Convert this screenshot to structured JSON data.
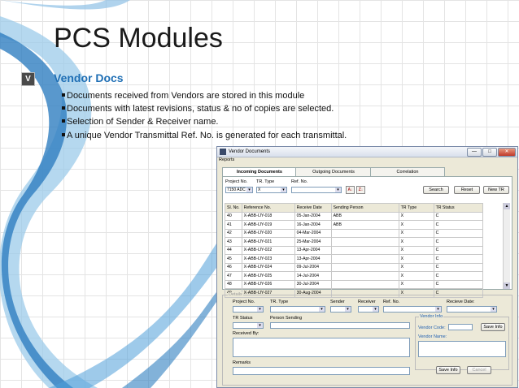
{
  "slide": {
    "title": "PCS Modules",
    "badge": "V",
    "subtitle": "Vendor Docs",
    "bullets": [
      "Documents received from Vendors are stored in this module",
      "Documents with latest revisions, status & no of copies are selected.",
      "Selection of Sender & Receiver name.",
      "A unique Vendor Transmittal Ref. No. is generated for each transmittal."
    ]
  },
  "window": {
    "title": "Vendor Documents",
    "menu": "Reports",
    "controls": {
      "minimize": "—",
      "maximize": "□",
      "close": "✕"
    },
    "tabs": [
      "Incoming Documents",
      "Outgoing Documents",
      "Correlation"
    ],
    "filters": {
      "project_label": "Project No.",
      "project_value": "7150 ADC",
      "tr_type_label": "TR. Type",
      "tr_type_value": "X",
      "ref_label": "Ref. No.",
      "ref_value": "",
      "sort_asc": "A↓",
      "sort_desc": "Z↓"
    },
    "buttons": {
      "search": "Search",
      "reset": "Reset",
      "new_tr": "New TR"
    },
    "table": {
      "columns": [
        "Sl. No.",
        "Reference No.",
        "Receive Date",
        "Sending Person",
        "TR Type",
        "TR Status"
      ],
      "rows": [
        [
          "40",
          "X-ABB-IJY-018",
          "05-Jan-2004",
          "ABB",
          "X",
          "C"
        ],
        [
          "41",
          "X-ABB-IJY-019",
          "16-Jan-2004",
          "ABB",
          "X",
          "C"
        ],
        [
          "42",
          "X-ABB-IJY-020",
          "04-Mar-2004",
          "",
          "X",
          "C"
        ],
        [
          "43",
          "X-ABB-IJY-021",
          "25-Mar-2004",
          "",
          "X",
          "C"
        ],
        [
          "44",
          "X-ABB-IJY-022",
          "13-Apr-2004",
          "",
          "X",
          "C"
        ],
        [
          "45",
          "X-ABB-IJY-023",
          "13-Apr-2004",
          "",
          "X",
          "C"
        ],
        [
          "46",
          "X-ABB-IJY-024",
          "09-Jul-2004",
          "",
          "X",
          "C"
        ],
        [
          "47",
          "X-ABB-IJY-025",
          "14-Jul-2004",
          "",
          "X",
          "C"
        ],
        [
          "48",
          "X-ABB-IJY-026",
          "30-Jul-2004",
          "",
          "X",
          "C"
        ],
        [
          "49",
          "X-ABB-IJY-027",
          "30-Aug-2004",
          "",
          "X",
          "C"
        ]
      ]
    },
    "details": {
      "legend": "Details",
      "project_label": "Project No.",
      "tr_type_label": "TR. Type",
      "sender_label": "Sender",
      "receiver_label": "Receiver",
      "ref_label": "Ref. No.",
      "receive_date_label": "Recieve Date:",
      "tr_status_label": "TR Status",
      "person_sending_label": "Person Sending",
      "received_by_label": "Received By:",
      "remarks_label": "Remarks",
      "vendor_info_legend": "Vendor Info",
      "vendor_code_label": "Vendor Code:",
      "vendor_name_label": "Vendor Name:",
      "save_info_small": "Save Info",
      "save_info": "Save Info",
      "cancel": "Cancel"
    }
  }
}
